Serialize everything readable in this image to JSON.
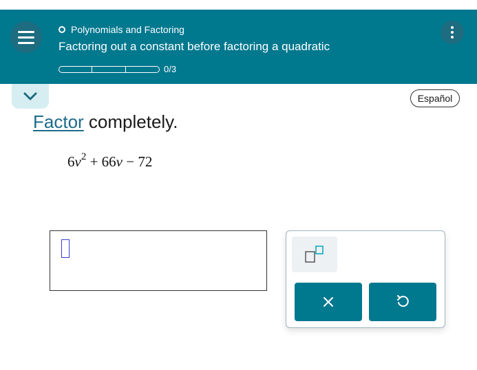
{
  "header": {
    "topic": "Polynomials and Factoring",
    "lesson_title": "Factoring out a constant before factoring a quadratic",
    "progress": {
      "label": "0/3",
      "completed": 0,
      "total": 3
    }
  },
  "language_button": "Español",
  "problem": {
    "prompt_link": "Factor",
    "prompt_rest": " completely.",
    "expression": {
      "coef": "6",
      "var": "v",
      "exp": "2",
      "middle": " + 66",
      "var2": "v",
      "tail": " − 72"
    }
  },
  "colors": {
    "header_bg": "#00788e",
    "link": "#1c6a8a",
    "button": "#00788e"
  },
  "icons": {
    "menu": "hamburger-icon",
    "more": "vertical-dots-icon",
    "collapse": "chevron-down-icon",
    "exponent": "exponent-template-icon",
    "clear": "x-icon",
    "undo": "undo-icon"
  }
}
